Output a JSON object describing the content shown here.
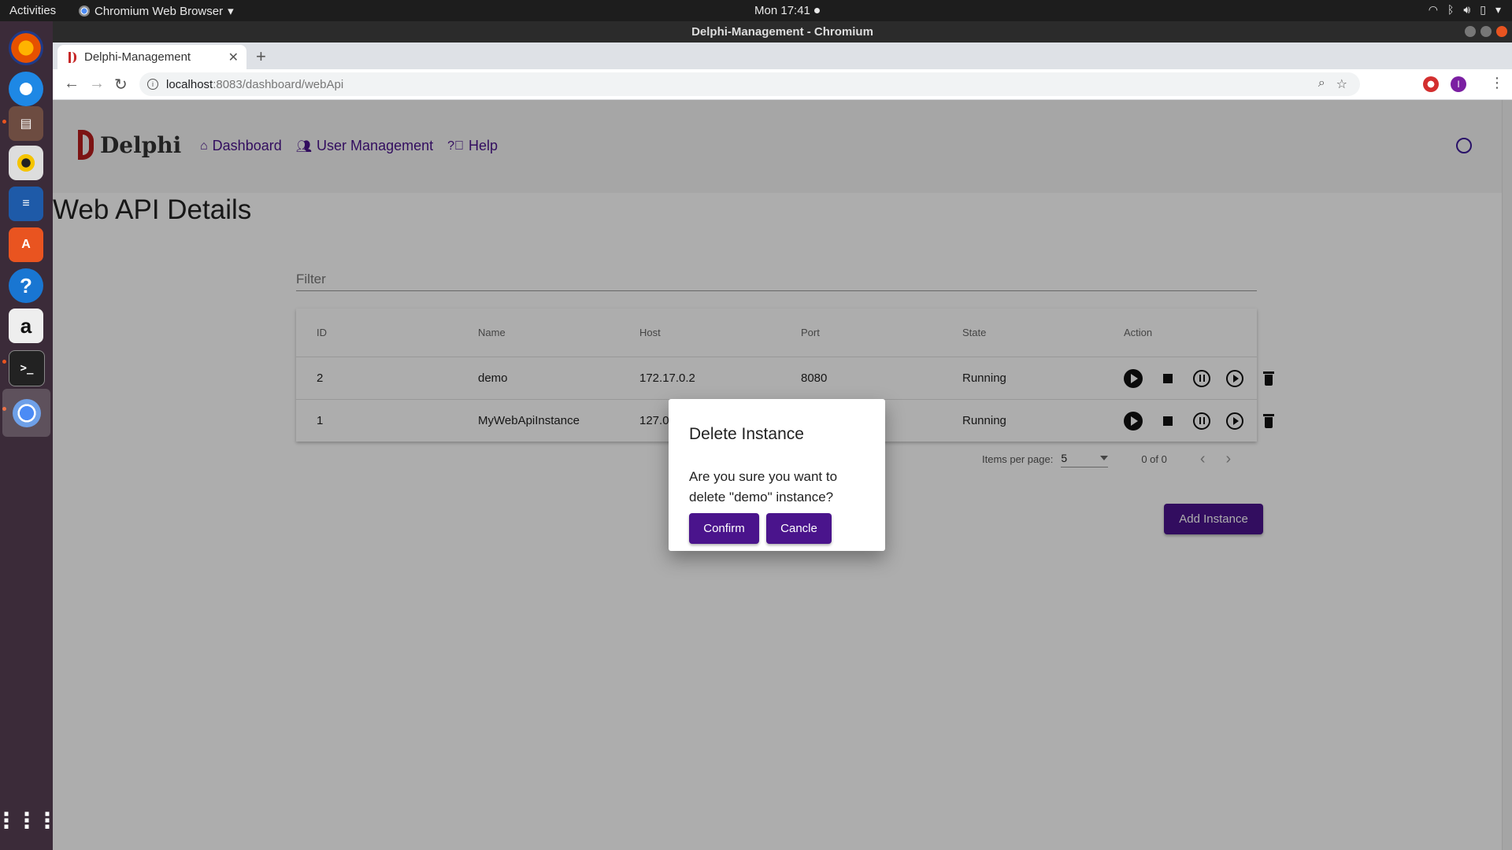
{
  "system": {
    "activities": "Activities",
    "app_name": "Chromium Web Browser",
    "clock": "Mon 17:41"
  },
  "window": {
    "title": "Delphi-Management - Chromium"
  },
  "browser": {
    "tab_title": "Delphi-Management",
    "url_host": "localhost",
    "url_path": ":8083/dashboard/webApi",
    "profile_initial": "I"
  },
  "nav": {
    "logo_text": "Delphi",
    "links": [
      {
        "label": "Dashboard"
      },
      {
        "label": "User Management"
      },
      {
        "label": "Help"
      }
    ]
  },
  "page": {
    "title": "Web API Details",
    "filter_placeholder": "Filter"
  },
  "table": {
    "headers": {
      "id": "ID",
      "name": "Name",
      "host": "Host",
      "port": "Port",
      "state": "State",
      "action": "Action"
    },
    "rows": [
      {
        "id": "2",
        "name": "demo",
        "host": "172.17.0.2",
        "port": "8080",
        "state": "Running"
      },
      {
        "id": "1",
        "name": "MyWebApiInstance",
        "host": "127.0",
        "port": "",
        "state": "Running"
      }
    ]
  },
  "paginator": {
    "items_per_page_label": "Items per page:",
    "items_per_page_value": "5",
    "range": "0 of 0"
  },
  "add_button": "Add Instance",
  "dialog": {
    "title": "Delete Instance",
    "message": "Are you sure you want to delete \"demo\" instance?",
    "confirm": "Confirm",
    "cancel": "Cancle"
  },
  "colors": {
    "accent": "#4a148c",
    "brand": "#b71c1c",
    "dock": "#3b2b39"
  }
}
